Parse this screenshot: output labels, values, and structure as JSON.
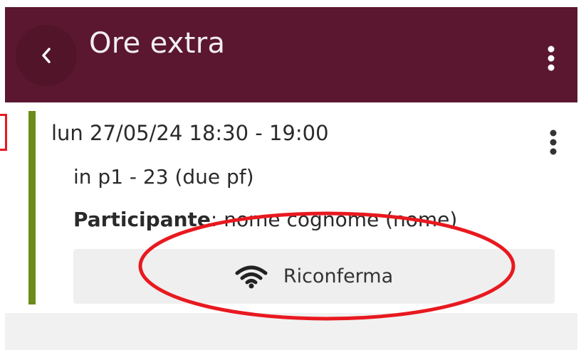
{
  "header": {
    "title": "Ore extra",
    "back_icon": "chevron-left-icon",
    "menu_icon": "more-vert-icon"
  },
  "entry": {
    "date_time": "lun 27/05/24 18:30 - 19:00",
    "location": "in p1 - 23 (due pf)",
    "participant_label": "Participante",
    "participant_value": ": nome cognome (nome)",
    "menu_icon": "more-vert-icon",
    "reconfirm_button": {
      "label": "Riconferma",
      "icon": "wifi-icon"
    }
  },
  "colors": {
    "header_bg": "#5b1730",
    "accent_bar": "#6a8c1c",
    "annotation": "#e8191f",
    "button_bg": "#efefef"
  }
}
